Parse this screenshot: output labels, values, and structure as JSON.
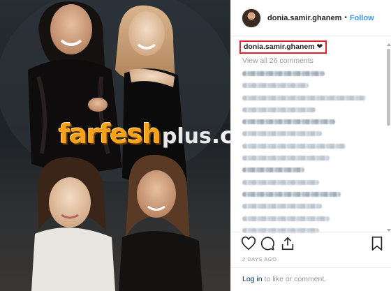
{
  "photo": {
    "watermark": {
      "main": "farfesh",
      "plus": "plus",
      "domain": ".com"
    }
  },
  "header": {
    "username": "donia.samir.ghanem",
    "separator": "•",
    "follow_label": "Follow"
  },
  "caption": {
    "username": "donia.samir.ghanem",
    "text": "❤"
  },
  "comments": {
    "view_all_label": "View all 26 comments",
    "rows": [
      {
        "style": "dark",
        "width": 0.62
      },
      {
        "style": "light",
        "width": 0.5
      },
      {
        "style": "light",
        "width": 0.93
      },
      {
        "style": "light",
        "width": 0.55
      },
      {
        "style": "dark",
        "width": 0.7
      },
      {
        "style": "light",
        "width": 0.6
      },
      {
        "style": "light",
        "width": 0.78
      },
      {
        "style": "light",
        "width": 0.66
      },
      {
        "style": "dark",
        "width": 0.47
      },
      {
        "style": "light",
        "width": 0.58
      },
      {
        "style": "dark",
        "width": 0.74
      },
      {
        "style": "light",
        "width": 0.6
      },
      {
        "style": "light",
        "width": 0.66
      },
      {
        "style": "light",
        "width": 0.58
      }
    ]
  },
  "timestamp": "2 DAYS AGO",
  "footer": {
    "login_label": "Log in",
    "rest": " to like or comment."
  },
  "icons": [
    "heart-icon",
    "comment-icon",
    "share-icon",
    "bookmark-icon"
  ]
}
